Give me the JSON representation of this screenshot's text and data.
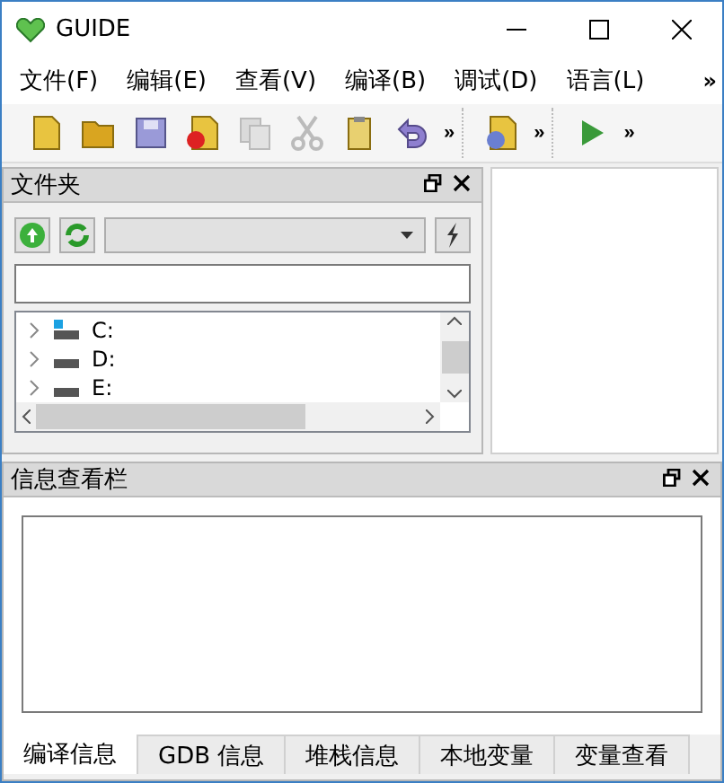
{
  "window": {
    "title": "GUIDE"
  },
  "menu": {
    "items": [
      "文件(F)",
      "编辑(E)",
      "查看(V)",
      "编译(B)",
      "调试(D)",
      "语言(L)"
    ],
    "overflow": "»"
  },
  "toolbar": {
    "groups": [
      {
        "tools": [
          {
            "kind": "new",
            "disabled": false
          },
          {
            "kind": "open",
            "disabled": false
          },
          {
            "kind": "save",
            "disabled": false
          },
          {
            "kind": "close",
            "disabled": false
          },
          {
            "kind": "copy",
            "disabled": true
          },
          {
            "kind": "cut",
            "disabled": true
          },
          {
            "kind": "paste",
            "disabled": false
          },
          {
            "kind": "undo",
            "disabled": false
          }
        ],
        "overflow": "»"
      },
      {
        "tools": [
          {
            "kind": "import",
            "disabled": false
          }
        ],
        "overflow": "»"
      },
      {
        "tools": [
          {
            "kind": "run",
            "disabled": false
          }
        ],
        "overflow": "»"
      }
    ]
  },
  "folder_panel": {
    "title": "文件夹",
    "drives": [
      {
        "label": "C:",
        "system": true,
        "expanded": false
      },
      {
        "label": "D:",
        "system": false,
        "expanded": false
      },
      {
        "label": "E:",
        "system": false,
        "expanded": false
      }
    ]
  },
  "info_panel": {
    "title": "信息查看栏",
    "tabs": [
      {
        "label": "编译信息",
        "selected": true
      },
      {
        "label": "GDB 信息",
        "selected": false
      },
      {
        "label": "堆栈信息",
        "selected": false
      },
      {
        "label": "本地变量",
        "selected": false
      },
      {
        "label": "变量查看",
        "selected": false
      }
    ]
  }
}
